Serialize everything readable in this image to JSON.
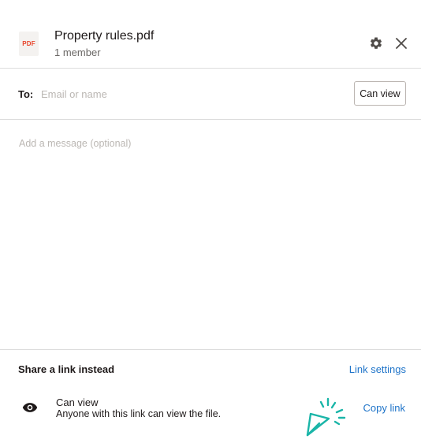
{
  "header": {
    "file_badge": "PDF",
    "title": "Property rules.pdf",
    "subtitle": "1 member",
    "settings_icon": "gear-icon",
    "close_icon": "close-icon"
  },
  "recipients": {
    "label": "To:",
    "placeholder": "Email or name",
    "value": "",
    "permission": "Can view"
  },
  "message": {
    "placeholder": "Add a message (optional)",
    "value": ""
  },
  "share_link": {
    "title": "Share a link instead",
    "settings_label": "Link settings",
    "permission_icon": "eye-icon",
    "permission_title": "Can view",
    "permission_description": "Anyone with this link can view the file.",
    "copy_label": "Copy link"
  },
  "colors": {
    "accent": "#1f74c9",
    "pdf_badge": "#e8452c",
    "cursor_highlight": "#1ab5a8",
    "divider": "#dcdcdc"
  }
}
